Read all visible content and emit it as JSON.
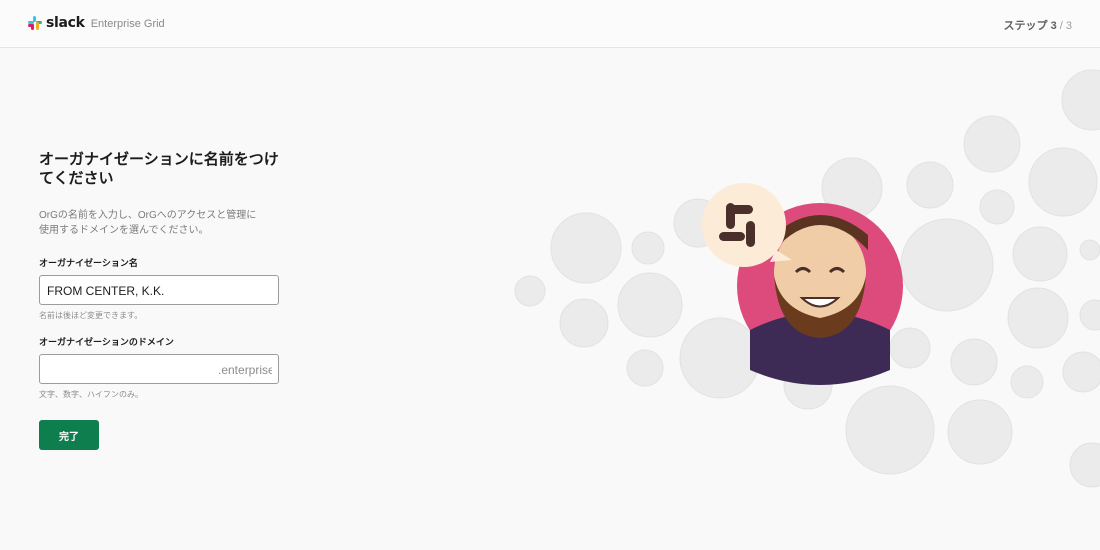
{
  "header": {
    "logo_icon": "slack-hash-logo-icon",
    "wordmark": "slack",
    "subbrand": "Enterprise Grid",
    "step_prefix": "ステップ 3",
    "step_suffix": " / 3"
  },
  "form": {
    "title_line1": "オーガナイゼーションに名前をつけ",
    "title_line2": "てください",
    "desc_line1": "OrGの名前を入力し、OrGへのアクセスと管理に",
    "desc_line2": "使用するドメインを選んでください。",
    "org_name_label": "オーガナイゼーション名",
    "org_name_value": "FROM CENTER, K.K.",
    "org_name_hint": "名前は後ほど変更できます。",
    "domain_label": "オーガナイゼーションのドメイン",
    "domain_value": "",
    "domain_suffix": ".enterprise",
    "domain_hint": "文字、数字、ハイフンのみ。",
    "submit_label": "完了"
  },
  "colors": {
    "primary_button": "#0f7e4f",
    "avatar_bg": "#dd4a7c",
    "bubble_bg": "#fcebd6",
    "logo_dark": "#4a2f2a"
  }
}
